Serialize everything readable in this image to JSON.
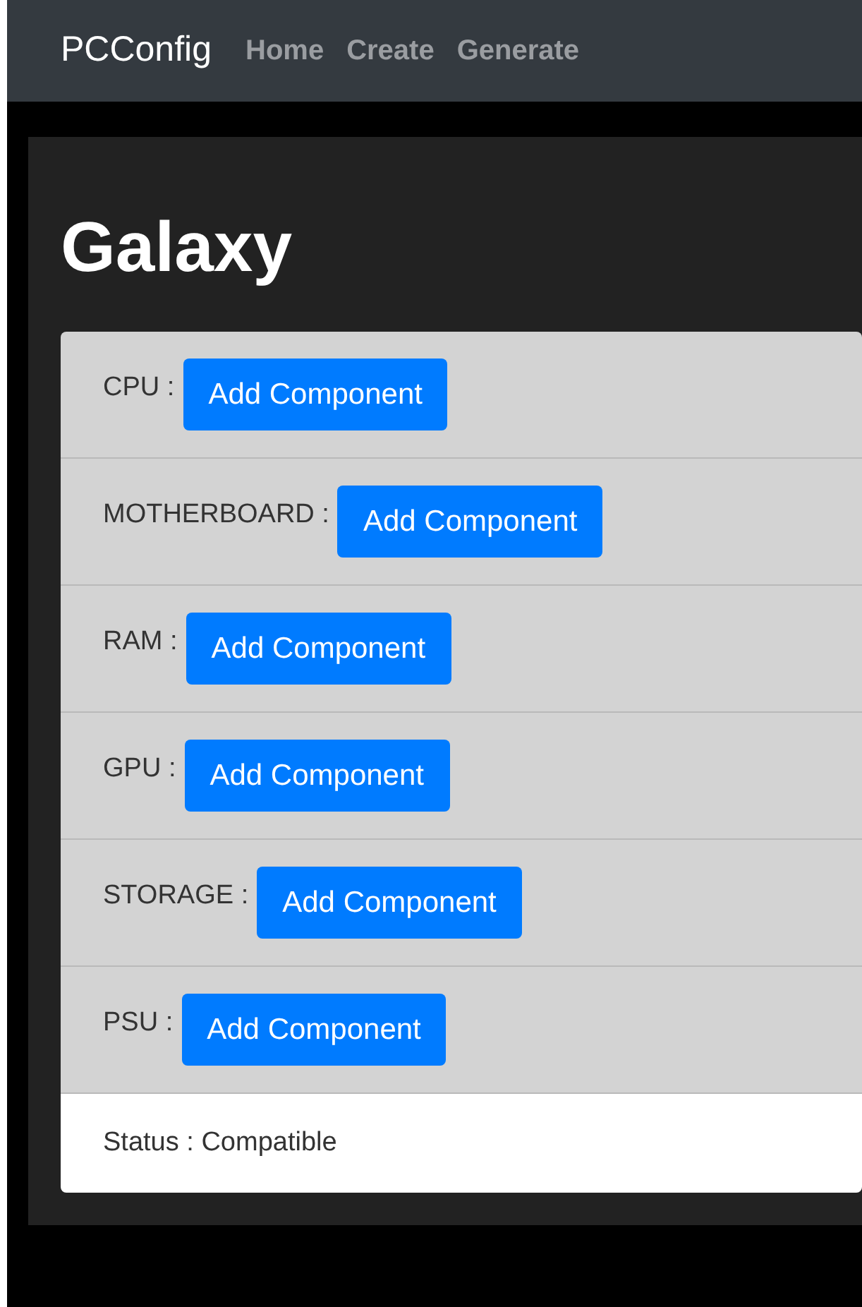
{
  "navbar": {
    "brand": "PCConfig",
    "links": [
      "Home",
      "Create",
      "Generate"
    ]
  },
  "build": {
    "title": "Galaxy",
    "components": [
      {
        "label": "CPU :",
        "button": "Add Component"
      },
      {
        "label": "MOTHERBOARD :",
        "button": "Add Component"
      },
      {
        "label": "RAM :",
        "button": "Add Component"
      },
      {
        "label": "GPU :",
        "button": "Add Component"
      },
      {
        "label": "STORAGE :",
        "button": "Add Component"
      },
      {
        "label": "PSU :",
        "button": "Add Component"
      }
    ],
    "status": "Status : Compatible"
  }
}
